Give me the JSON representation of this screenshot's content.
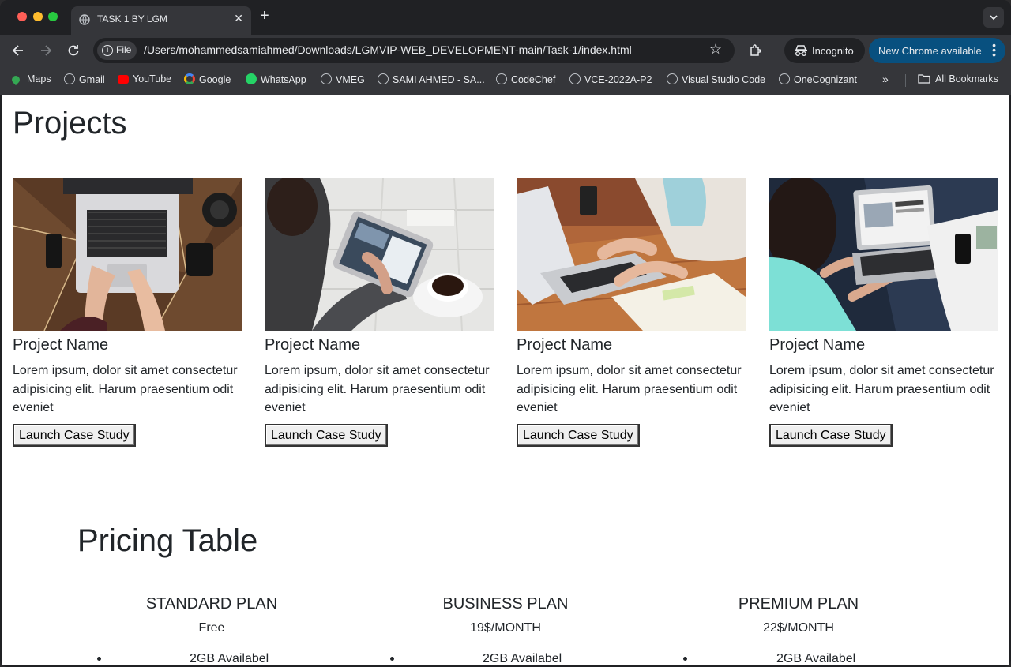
{
  "browser": {
    "tab_title": "TASK 1 BY LGM",
    "url_scheme_label": "File",
    "url": "/Users/mohammedsamiahmed/Downloads/LGMVIP-WEB_DEVELOPMENT-main/Task-1/index.html",
    "incognito_label": "Incognito",
    "update_label": "New Chrome available",
    "bookmarks": [
      {
        "label": "Maps",
        "icon": "maps-icon",
        "color": "#34a853"
      },
      {
        "label": "Gmail",
        "icon": "globe-icon",
        "color": "#bdc1c6"
      },
      {
        "label": "YouTube",
        "icon": "youtube-icon",
        "color": "#ff0000"
      },
      {
        "label": "Google",
        "icon": "google-icon",
        "color": "#4285f4"
      },
      {
        "label": "WhatsApp",
        "icon": "whatsapp-icon",
        "color": "#25d366"
      },
      {
        "label": "VMEG",
        "icon": "globe-icon",
        "color": "#bdc1c6"
      },
      {
        "label": "SAMI AHMED - SA...",
        "icon": "globe-icon",
        "color": "#bdc1c6"
      },
      {
        "label": "CodeChef",
        "icon": "globe-icon",
        "color": "#bdc1c6"
      },
      {
        "label": "VCE-2022A-P2",
        "icon": "globe-icon",
        "color": "#bdc1c6"
      },
      {
        "label": "Visual Studio Code",
        "icon": "globe-icon",
        "color": "#bdc1c6"
      },
      {
        "label": "OneCognizant",
        "icon": "globe-icon",
        "color": "#bdc1c6"
      }
    ],
    "all_bookmarks_label": "All Bookmarks"
  },
  "projects": {
    "title": "Projects",
    "cards": [
      {
        "name": "Project Name",
        "description": "Lorem ipsum, dolor sit amet consectetur adipisicing elit. Harum praesentium odit eveniet",
        "button": "Launch Case Study",
        "image": "laptop-top-view-photo"
      },
      {
        "name": "Project Name",
        "description": "Lorem ipsum, dolor sit amet consectetur adipisicing elit. Harum praesentium odit eveniet",
        "button": "Launch Case Study",
        "image": "tablet-coffee-photo"
      },
      {
        "name": "Project Name",
        "description": "Lorem ipsum, dolor sit amet consectetur adipisicing elit. Harum praesentium odit eveniet",
        "button": "Launch Case Study",
        "image": "laptop-desk-photo"
      },
      {
        "name": "Project Name",
        "description": "Lorem ipsum, dolor sit amet consectetur adipisicing elit. Harum praesentium odit eveniet",
        "button": "Launch Case Study",
        "image": "woman-laptop-photo"
      }
    ]
  },
  "pricing": {
    "title": "Pricing Table",
    "plans": [
      {
        "name": "STANDARD PLAN",
        "price": "Free",
        "feature": "2GB Availabel"
      },
      {
        "name": "BUSINESS PLAN",
        "price": "19$/MONTH",
        "feature": "2GB Availabel"
      },
      {
        "name": "PREMIUM PLAN",
        "price": "22$/MONTH",
        "feature": "2GB Availabel"
      }
    ]
  }
}
